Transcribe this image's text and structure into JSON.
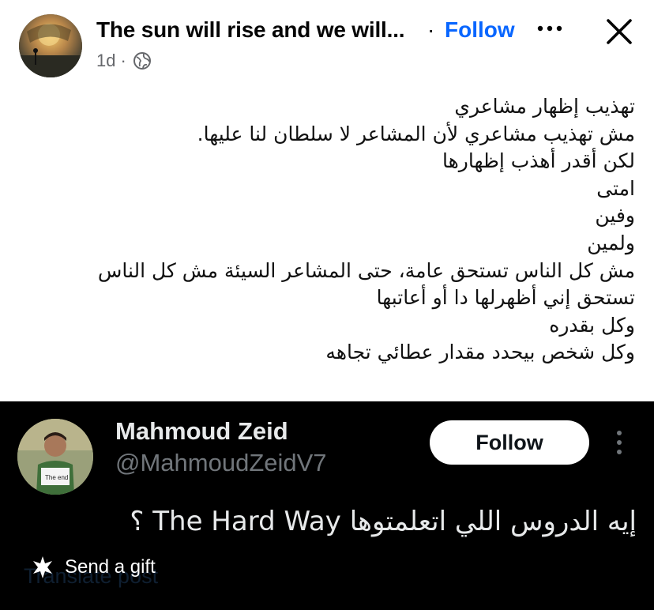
{
  "post": {
    "page_name": "The sun will rise and we will...",
    "separator": "·",
    "follow_label": "Follow",
    "time": "1d",
    "meta_separator": "·",
    "privacy_icon": "globe-icon",
    "body_lines": [
      "تهذيب إظهار مشاعري",
      "مش تهذيب مشاعري لأن المشاعر لا سلطان لنا عليها.",
      "لكن أقدر أهذب إظهارها",
      "امتى",
      "وفين",
      "ولمين",
      "مش كل الناس تستحق عامة، حتى المشاعر السيئة مش كل الناس",
      "تستحق إني أظهرلها دا أو أعاتبها",
      "وكل بقدره",
      "وكل شخص بيحدد مقدار عطائي تجاهه"
    ]
  },
  "embed": {
    "name": "Mahmoud Zeid",
    "handle": "@MahmoudZeidV7",
    "follow_label": "Follow",
    "text": "إيه الدروس اللي اتعلمتوها The Hard Way ؟",
    "translate_label": "Translate post"
  },
  "gift": {
    "label": "Send a gift",
    "icon": "gift-icon"
  },
  "colors": {
    "facebook_blue": "#0866ff",
    "twitter_bg": "#000000",
    "muted": "#65676b"
  }
}
